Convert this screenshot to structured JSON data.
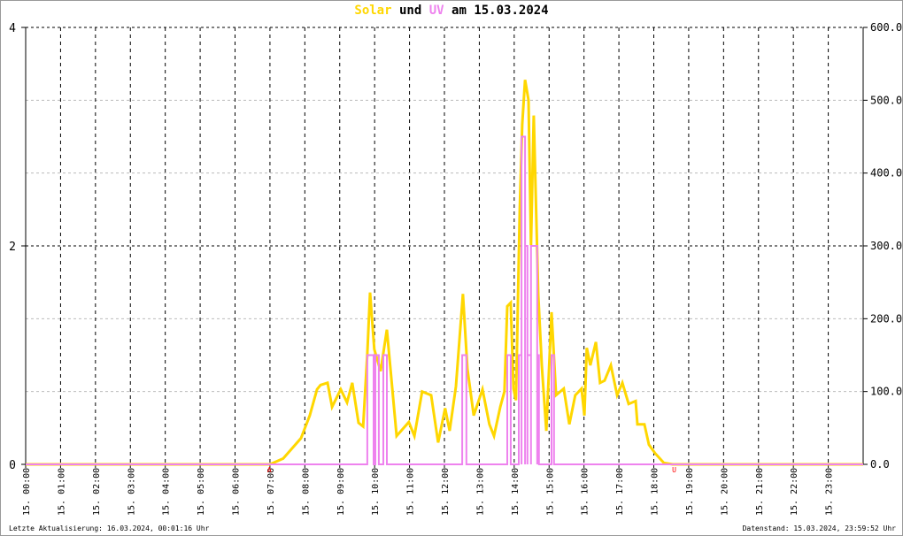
{
  "title": {
    "solar": "Solar",
    "und": "und",
    "uv": "UV",
    "date_prefix": "am",
    "date": "15.03.2024"
  },
  "footer": {
    "last_update": "Letzte Aktualisierung: 16.03.2024, 00:01:16 Uhr",
    "data_state": "Datenstand: 15.03.2024, 23:59:52 Uhr"
  },
  "colors": {
    "solar": "#ffd700",
    "uv": "#ee82ee",
    "marker": "#ff0000"
  },
  "chart_data": {
    "type": "line",
    "title": "Solar und UV am 15.03.2024",
    "x_range_hours": [
      0,
      24
    ],
    "x_tick_labels": [
      "15. 00:00",
      "15. 01:00",
      "15. 02:00",
      "15. 03:00",
      "15. 04:00",
      "15. 05:00",
      "15. 06:00",
      "15. 07:00",
      "15. 08:00",
      "15. 09:00",
      "15. 10:00",
      "15. 11:00",
      "15. 12:00",
      "15. 13:00",
      "15. 14:00",
      "15. 15:00",
      "15. 16:00",
      "15. 17:00",
      "15. 18:00",
      "15. 19:00",
      "15. 20:00",
      "15. 21:00",
      "15. 22:00",
      "15. 23:00"
    ],
    "left_axis": {
      "range": [
        0,
        4
      ],
      "ticks": [
        "0",
        "2",
        "4"
      ],
      "series": "UV"
    },
    "right_axis": {
      "range": [
        0,
        600
      ],
      "ticks": [
        "0.0",
        "100.0",
        "200.0",
        "300.0",
        "400.0",
        "500.0",
        "600.0"
      ],
      "series": "Solar"
    },
    "markers": [
      {
        "label": "A",
        "hour": 7.0
      },
      {
        "label": "U",
        "hour": 18.6
      }
    ],
    "series": [
      {
        "name": "Solar",
        "axis": "right",
        "points": [
          [
            0,
            0
          ],
          [
            7.0,
            0
          ],
          [
            7.38,
            8
          ],
          [
            7.89,
            36
          ],
          [
            8.14,
            67
          ],
          [
            8.35,
            103
          ],
          [
            8.45,
            109
          ],
          [
            8.65,
            112
          ],
          [
            8.78,
            79
          ],
          [
            9.03,
            103
          ],
          [
            9.21,
            85
          ],
          [
            9.36,
            112
          ],
          [
            9.54,
            57
          ],
          [
            9.67,
            52
          ],
          [
            9.79,
            152
          ],
          [
            9.87,
            236
          ],
          [
            9.99,
            158
          ],
          [
            10.17,
            128
          ],
          [
            10.35,
            185
          ],
          [
            10.63,
            39
          ],
          [
            10.98,
            58
          ],
          [
            11.14,
            39
          ],
          [
            11.36,
            100
          ],
          [
            11.62,
            95
          ],
          [
            11.82,
            30
          ],
          [
            12.02,
            77
          ],
          [
            12.15,
            46
          ],
          [
            12.33,
            107
          ],
          [
            12.53,
            234
          ],
          [
            12.66,
            131
          ],
          [
            12.84,
            67
          ],
          [
            13.09,
            103
          ],
          [
            13.29,
            55
          ],
          [
            13.42,
            39
          ],
          [
            13.6,
            79
          ],
          [
            13.72,
            100
          ],
          [
            13.8,
            217
          ],
          [
            13.9,
            222
          ],
          [
            13.98,
            104
          ],
          [
            14.05,
            88
          ],
          [
            14.16,
            350
          ],
          [
            14.23,
            467
          ],
          [
            14.31,
            528
          ],
          [
            14.41,
            500
          ],
          [
            14.48,
            301
          ],
          [
            14.56,
            479
          ],
          [
            14.69,
            233
          ],
          [
            14.79,
            136
          ],
          [
            14.92,
            46
          ],
          [
            15.07,
            209
          ],
          [
            15.2,
            95
          ],
          [
            15.42,
            104
          ],
          [
            15.58,
            55
          ],
          [
            15.75,
            95
          ],
          [
            15.93,
            104
          ],
          [
            16.01,
            67
          ],
          [
            16.08,
            160
          ],
          [
            16.18,
            136
          ],
          [
            16.34,
            168
          ],
          [
            16.46,
            112
          ],
          [
            16.59,
            115
          ],
          [
            16.77,
            136
          ],
          [
            16.95,
            95
          ],
          [
            17.1,
            112
          ],
          [
            17.28,
            83
          ],
          [
            17.48,
            87
          ],
          [
            17.53,
            55
          ],
          [
            17.73,
            55
          ],
          [
            17.86,
            27
          ],
          [
            18.04,
            15
          ],
          [
            18.29,
            2
          ],
          [
            18.54,
            0
          ],
          [
            24,
            0
          ]
        ]
      },
      {
        "name": "UV",
        "axis": "left",
        "segments": [
          [
            9.79,
            9.97,
            1
          ],
          [
            10.02,
            10.12,
            1
          ],
          [
            10.25,
            10.35,
            1
          ],
          [
            12.51,
            12.63,
            1
          ],
          [
            13.8,
            13.9,
            1
          ],
          [
            14.13,
            14.21,
            1
          ],
          [
            14.21,
            14.31,
            3
          ],
          [
            14.31,
            14.38,
            2
          ],
          [
            14.38,
            14.48,
            1
          ],
          [
            14.48,
            14.66,
            2
          ],
          [
            14.66,
            14.71,
            1
          ],
          [
            15.07,
            15.14,
            1
          ]
        ]
      }
    ]
  }
}
